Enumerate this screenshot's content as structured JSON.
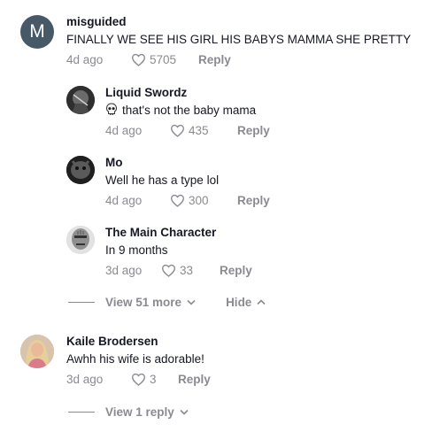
{
  "comments": [
    {
      "avatar_letter": "M",
      "username": "misguided",
      "text": "FINALLY WE SEE HIS GIRL HIS BABYS MAMMA SHE PRETTY",
      "time": "4d ago",
      "likes": "5705",
      "reply_label": "Reply"
    },
    {
      "username": "Kaile Brodersen",
      "text": "Awhh his wife is adorable!",
      "time": "3d ago",
      "likes": "3",
      "reply_label": "Reply"
    }
  ],
  "replies": [
    {
      "username": "Liquid Swordz",
      "text": "that's not the baby mama",
      "emoji_icon": "skull-icon",
      "time": "4d ago",
      "likes": "435",
      "reply_label": "Reply"
    },
    {
      "username": "Mo",
      "text": "Well he has a type lol",
      "time": "4d ago",
      "likes": "300",
      "reply_label": "Reply"
    },
    {
      "username": "The Main Character",
      "text": "In 9 months",
      "time": "3d ago",
      "likes": "33",
      "reply_label": "Reply"
    }
  ],
  "thread_controls": {
    "view_more_label": "View 51 more",
    "hide_label": "Hide"
  },
  "second_thread": {
    "view_reply_label": "View 1 reply"
  },
  "colors": {
    "text": "#161823",
    "muted": "#8a8b91",
    "avatar_letter_bg": "#475867"
  }
}
